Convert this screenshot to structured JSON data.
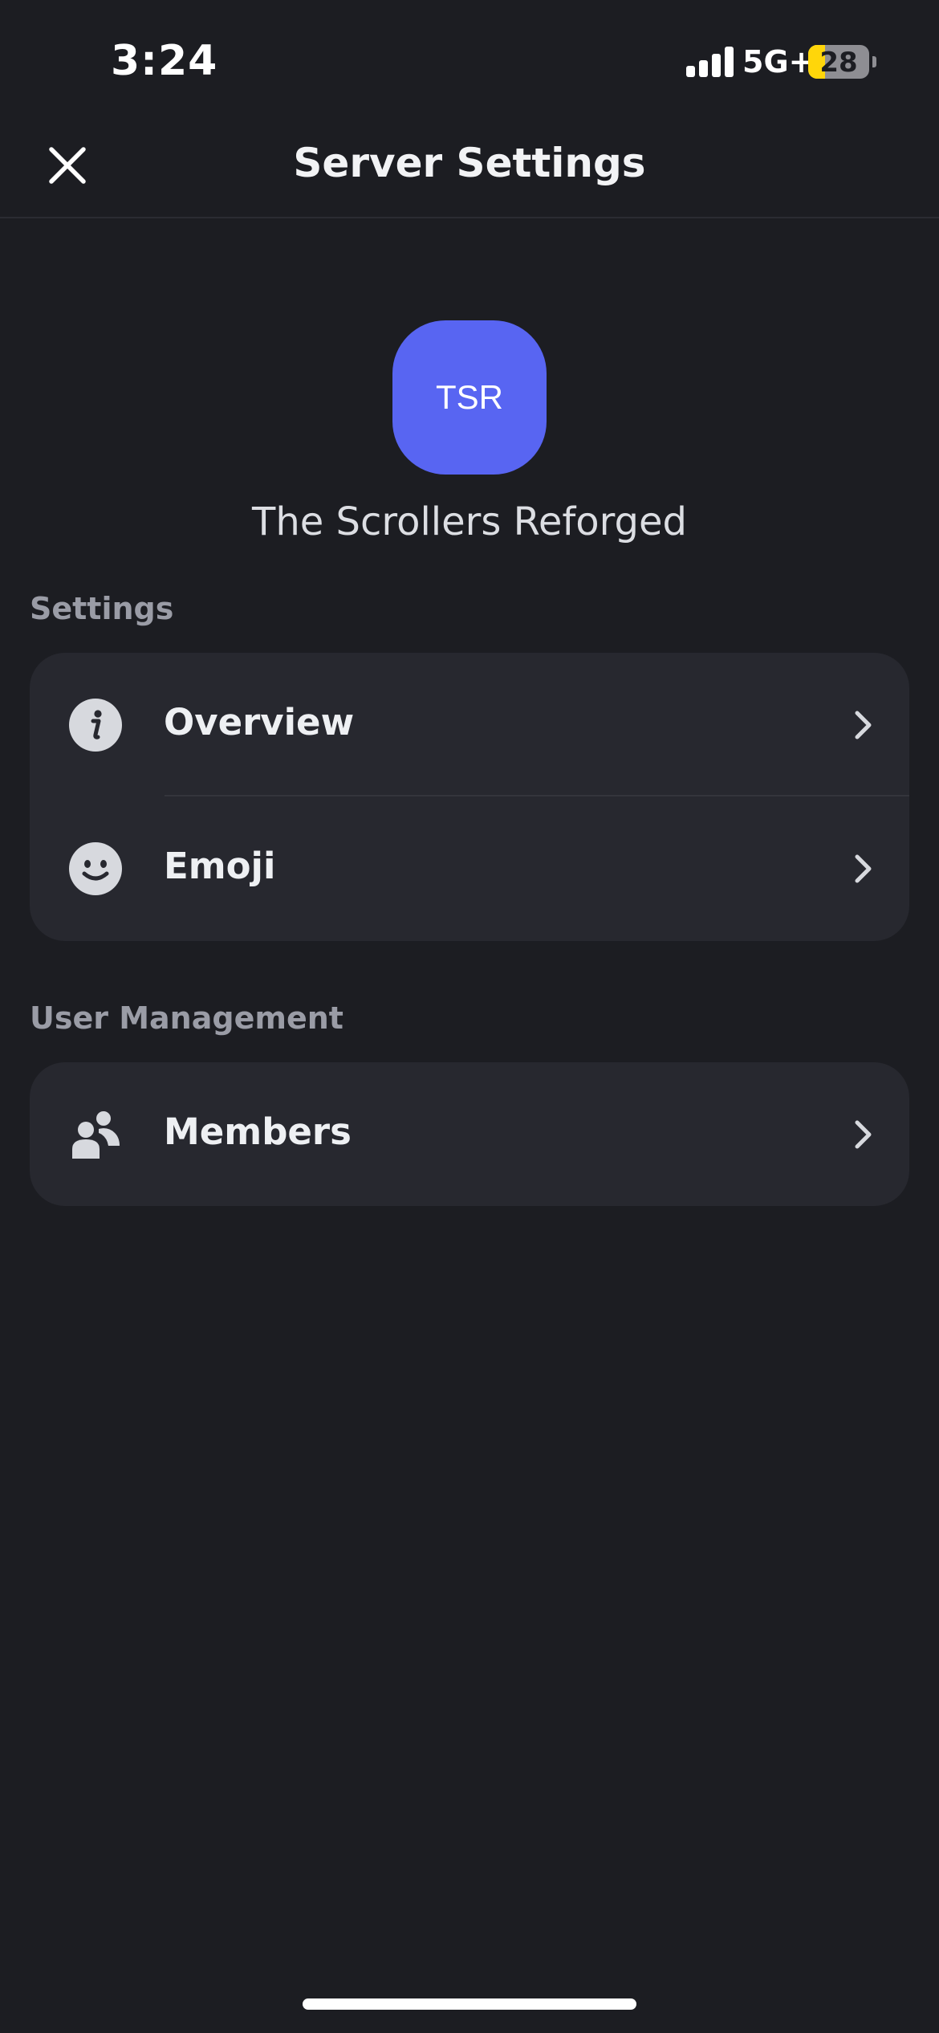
{
  "status_bar": {
    "time": "3:24",
    "network": "5G+",
    "battery_level": "28",
    "battery_fraction": 0.28,
    "signal_bars": 4
  },
  "header": {
    "title": "Server Settings",
    "close_icon": "close-icon"
  },
  "server": {
    "avatar_initials": "TSR",
    "avatar_color": "#5865f2",
    "name": "The Scrollers Reforged"
  },
  "sections": [
    {
      "title": "Settings",
      "items": [
        {
          "label": "Overview",
          "icon": "info-icon"
        },
        {
          "label": "Emoji",
          "icon": "emoji-icon"
        }
      ]
    },
    {
      "title": "User Management",
      "items": [
        {
          "label": "Members",
          "icon": "members-icon"
        }
      ]
    }
  ],
  "colors": {
    "background": "#1c1d22",
    "card": "#27282f",
    "accent": "#5865f2",
    "battery": "#ffd60a"
  }
}
